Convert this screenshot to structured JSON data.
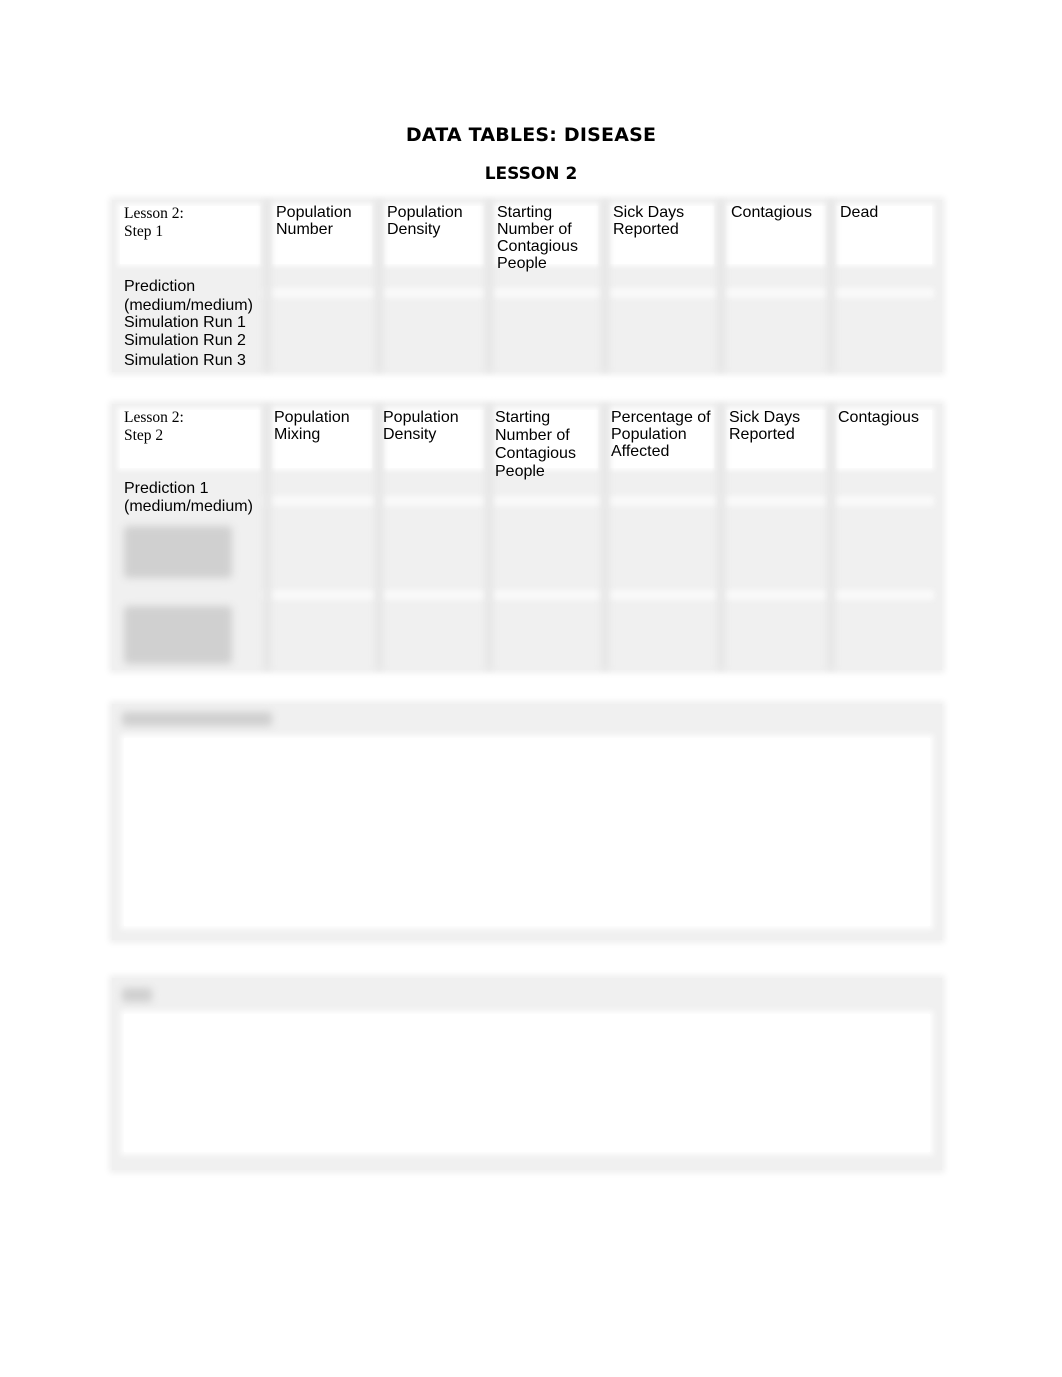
{
  "document": {
    "title": "DATA TABLES: DISEASE",
    "subtitle": "LESSON 2"
  },
  "table1": {
    "corner": "Lesson 2:\nStep 1",
    "headers": [
      "Population\nNumber",
      "Population\nDensity",
      "Starting\nNumber of\nContagious\nPeople",
      "Sick Days\nReported",
      "Contagious",
      "Dead"
    ],
    "rows": [
      "Prediction\n(medium/medium)",
      "Simulation Run 1",
      "Simulation Run 2",
      "Simulation Run 3"
    ]
  },
  "table2": {
    "corner": "Lesson 2:\nStep 2",
    "headers": [
      "Population\nMixing",
      "Population\nDensity",
      "Starting\nNumber of\nContagious\nPeople",
      "Percentage of\nPopulation\nAffected",
      "Sick Days\nReported",
      "Contagious"
    ],
    "rows": [
      "Prediction 1\n(medium/medium)"
    ],
    "obscured_rows_count": 7
  },
  "boxes": [
    {
      "label_obscured": true
    },
    {
      "label_obscured": true
    }
  ]
}
